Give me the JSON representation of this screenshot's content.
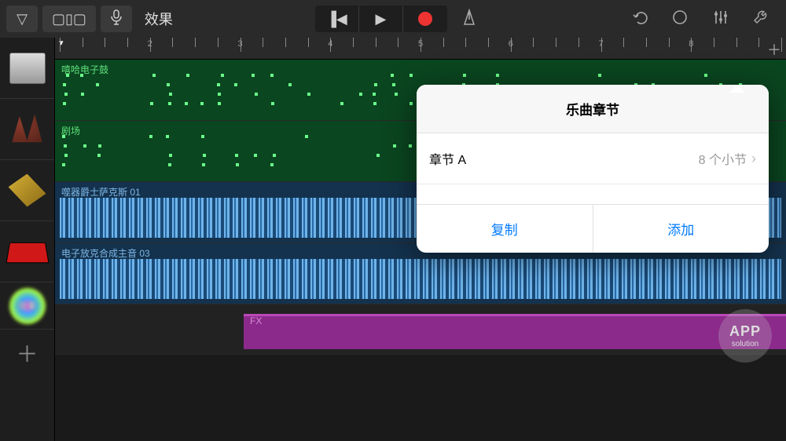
{
  "toolbar": {
    "effects_label": "效果"
  },
  "ruler": {
    "start_marker": "▾",
    "numbers": [
      "2",
      "3",
      "4",
      "5",
      "6",
      "7",
      "8"
    ]
  },
  "tracks": [
    {
      "label": "嘻哈电子鼓",
      "kind": "green-midi"
    },
    {
      "label": "剧场",
      "kind": "green-midi"
    },
    {
      "label": "噬器爵士萨克斯 01",
      "kind": "blue-audio"
    },
    {
      "label": "电子放克合成主音 03",
      "kind": "blue-audio"
    },
    {
      "label": "FX",
      "kind": "purple-fx"
    }
  ],
  "popover": {
    "title": "乐曲章节",
    "row": {
      "name": "章节 A",
      "value": "8 个小节"
    },
    "copy": "复制",
    "add": "添加"
  },
  "watermark": {
    "line1": "APP",
    "line2": "solution"
  }
}
